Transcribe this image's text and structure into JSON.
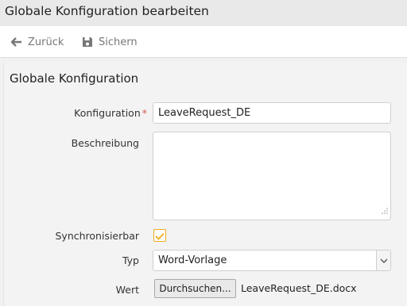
{
  "window": {
    "title": "Globale Konfiguration bearbeiten"
  },
  "toolbar": {
    "back_label": "Zurück",
    "save_label": "Sichern"
  },
  "form": {
    "section_title": "Globale Konfiguration",
    "konfiguration": {
      "label": "Konfiguration",
      "required_mark": "*",
      "value": "LeaveRequest_DE"
    },
    "beschreibung": {
      "label": "Beschreibung",
      "value": ""
    },
    "synchronisierbar": {
      "label": "Synchronisierbar",
      "checked": true
    },
    "typ": {
      "label": "Typ",
      "selected": "Word-Vorlage"
    },
    "wert": {
      "label": "Wert",
      "browse_label": "Durchsuchen...",
      "filename": "LeaveRequest_DE.docx"
    }
  },
  "colors": {
    "accent_checkbox": "#f0ad1c",
    "required": "#d9534f"
  }
}
